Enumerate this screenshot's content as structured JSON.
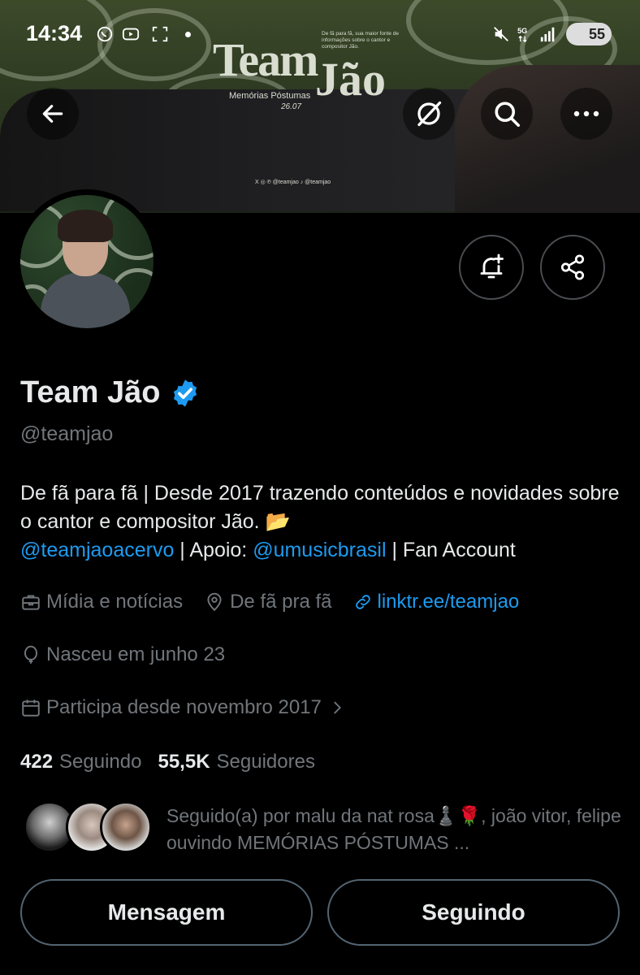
{
  "status_bar": {
    "time": "14:34",
    "battery": "55"
  },
  "banner": {
    "title_line1": "Team",
    "title_line2": "Jão",
    "subtitle": "Memórias Póstumas",
    "date": "26.07",
    "small_text": "De fã para fã, sua maior fonte de informações sobre o cantor e compositor Jão.",
    "social_text": "X ◎ ℗ @teamjao  ♪ @teamjao"
  },
  "profile": {
    "name": "Team Jão",
    "handle": "@teamjao",
    "bio_part1": "De fã para fã | Desde 2017 trazendo conteúdos e novidades sobre o cantor e compositor Jão. 📂",
    "bio_link1": "@teamjaoacervo",
    "bio_sep": " | Apoio: ",
    "bio_link2": "@umusicbrasil",
    "bio_end": " | Fan Account",
    "category": "Mídia e notícias",
    "location": "De fã pra fã",
    "website": "linktr.ee/teamjao",
    "birthday": "Nasceu em junho 23",
    "joined": "Participa desde novembro 2017",
    "following_count": "422",
    "following_label": "Seguindo",
    "followers_count": "55,5K",
    "followers_label": "Seguidores",
    "followed_by": "Seguido(a) por malu da nat rosa♟️🌹, joão vitor, felipe ouvindo MEMÓRIAS PÓSTUMAS ..."
  },
  "actions": {
    "message": "Mensagem",
    "following": "Seguindo"
  },
  "colors": {
    "accent": "#1d9bf0",
    "muted": "#71767b",
    "text": "#e7e9ea",
    "background": "#000000"
  }
}
